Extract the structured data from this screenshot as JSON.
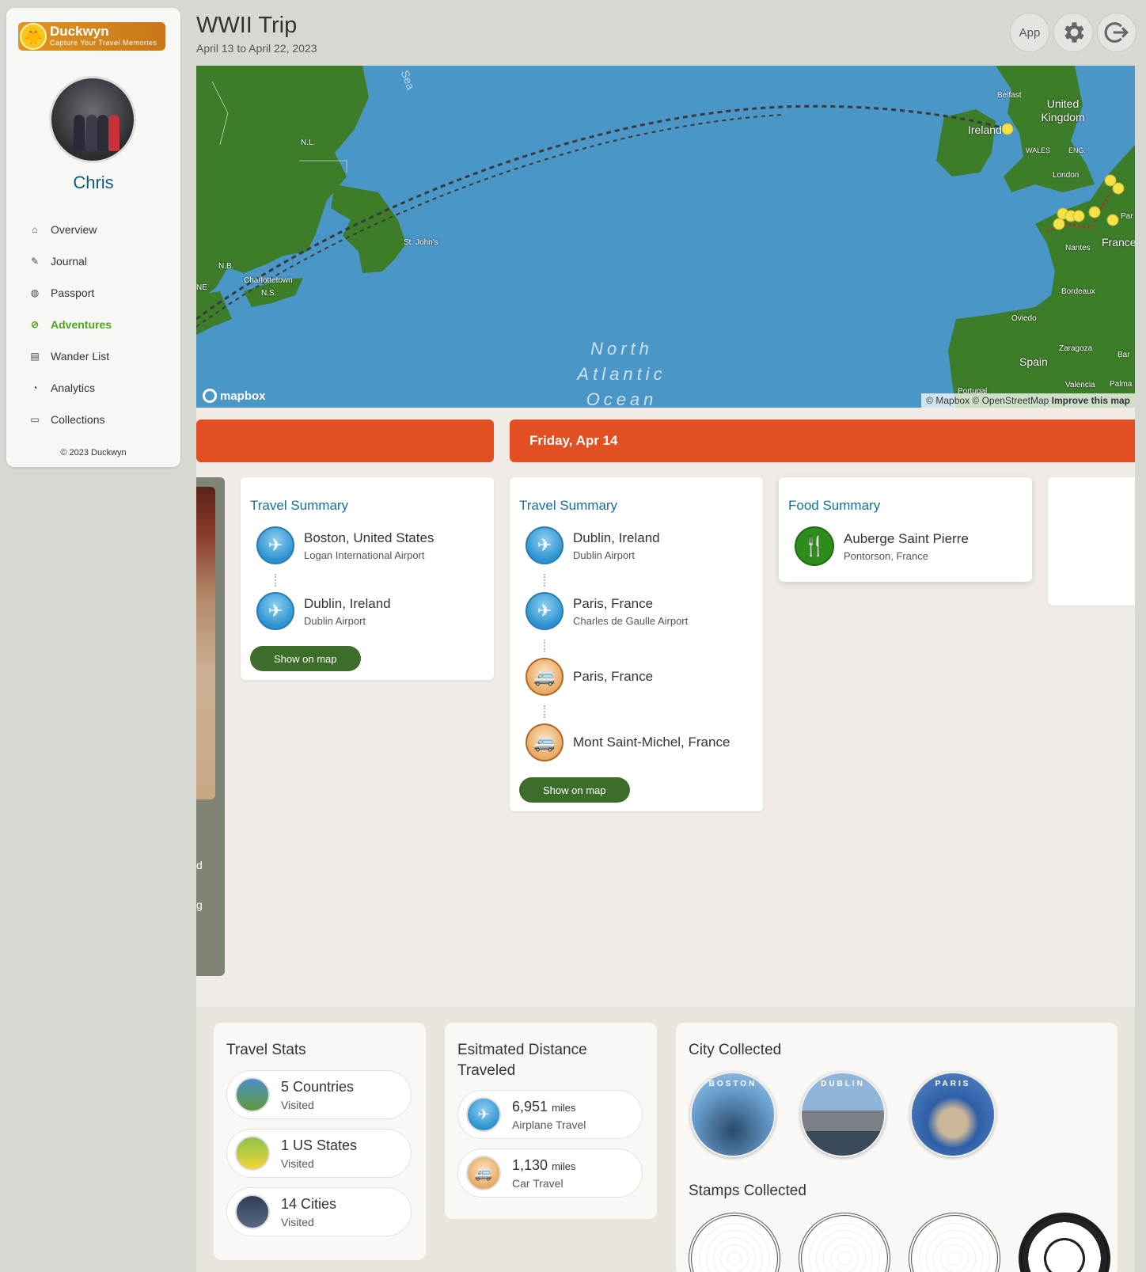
{
  "sidebar": {
    "logo_name": "Duckwyn",
    "logo_tagline": "Capture Your Travel Memories",
    "user_name": "Chris",
    "nav": [
      {
        "label": "Overview",
        "icon": "home-icon"
      },
      {
        "label": "Journal",
        "icon": "pencil-icon"
      },
      {
        "label": "Passport",
        "icon": "globe-icon"
      },
      {
        "label": "Adventures",
        "icon": "compass-icon",
        "active": true
      },
      {
        "label": "Wander List",
        "icon": "list-icon"
      },
      {
        "label": "Analytics",
        "icon": "gauge-icon"
      },
      {
        "label": "Collections",
        "icon": "archive-icon"
      }
    ],
    "copyright": "© 2023 Duckwyn"
  },
  "header": {
    "title": "WWII Trip",
    "dates": "April 13 to April 22, 2023",
    "app_button": "App",
    "settings_icon": "gear-icon",
    "logout_icon": "logout-icon"
  },
  "map": {
    "labels": {
      "sea": "Sea",
      "nl": "N.L.",
      "nb": "N.B.",
      "ns": "N.S.",
      "ne": "NE",
      "charlottetown": "Charlottetown",
      "st_johns": "St. John's",
      "belfast": "Belfast",
      "ireland": "Ireland",
      "uk": "United Kingdom",
      "wales": "WALES",
      "eng": "ENG.",
      "london": "London",
      "nantes": "Nantes",
      "france": "France",
      "bordeaux": "Bordeaux",
      "oviedo": "Oviedo",
      "zaragoza": "Zaragoza",
      "spain": "Spain",
      "valencia": "Valencia",
      "palma": "Palma",
      "portugal": "Portugal",
      "bar": "Bar",
      "par": "Par"
    },
    "ocean_label": "North Atlantic Ocean",
    "mapbox_logo": "mapbox",
    "attribution": "© Mapbox © OpenStreetMap",
    "improve": "Improve this map"
  },
  "timeline": {
    "photo_text_1": "d",
    "photo_text_2": "g",
    "day2_label": "Friday, Apr 14",
    "card1": {
      "title": "Travel Summary",
      "stops": [
        {
          "city": "Boston, United States",
          "sub": "Logan International Airport",
          "icon": "airplane-icon"
        },
        {
          "city": "Dublin, Ireland",
          "sub": "Dublin Airport",
          "icon": "airplane-icon"
        }
      ],
      "button": "Show on map"
    },
    "card2": {
      "title": "Travel Summary",
      "stops": [
        {
          "city": "Dublin, Ireland",
          "sub": "Dublin Airport",
          "icon": "airplane-icon"
        },
        {
          "city": "Paris, France",
          "sub": "Charles de Gaulle Airport",
          "icon": "airplane-icon"
        },
        {
          "city": "Paris, France",
          "sub": "",
          "icon": "car-icon"
        },
        {
          "city": "Mont Saint-Michel, France",
          "sub": "",
          "icon": "car-icon"
        }
      ],
      "button": "Show on map"
    },
    "card3": {
      "title": "Food Summary",
      "name": "Auberge Saint Pierre",
      "place": "Pontorson, France",
      "icon": "dinner-icon"
    }
  },
  "stats": {
    "travel_title": "Travel Stats",
    "travel": [
      {
        "value": "5 Countries",
        "label": "Visited"
      },
      {
        "value": "1 US States",
        "label": "Visited"
      },
      {
        "value": "14 Cities",
        "label": "Visited"
      }
    ],
    "distance_title": "Esitmated Distance Traveled",
    "distance": [
      {
        "value": "6,951",
        "unit": "miles",
        "label": "Airplane Travel"
      },
      {
        "value": "1,130",
        "unit": "miles",
        "label": "Car Travel"
      }
    ],
    "city_title": "City Collected",
    "cities": [
      "BOSTON",
      "DUBLIN",
      "PARIS"
    ],
    "stamps_title": "Stamps Collected"
  }
}
